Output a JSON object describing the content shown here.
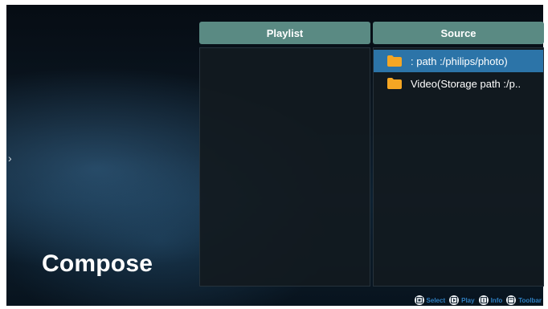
{
  "screen": {
    "title": "Compose"
  },
  "playlist": {
    "header": "Playlist",
    "items": []
  },
  "source": {
    "header": "Source",
    "items": [
      {
        "label": ": path :/philips/photo)",
        "icon": "folder-icon",
        "selected": true
      },
      {
        "label": "Video(Storage path :/p..",
        "icon": "folder-icon",
        "selected": false
      }
    ]
  },
  "footer": {
    "hints": [
      {
        "label": "Select",
        "icon": "select-key-icon"
      },
      {
        "label": "Play",
        "icon": "play-key-icon"
      },
      {
        "label": "Info",
        "icon": "info-key-icon"
      },
      {
        "label": "Toolbar",
        "icon": "toolbar-key-icon"
      }
    ]
  },
  "colors": {
    "header_bg": "#5a8a83",
    "selected_bg": "#2c74a8",
    "folder": "#f5a623",
    "hint_text": "#2f7fc1"
  }
}
